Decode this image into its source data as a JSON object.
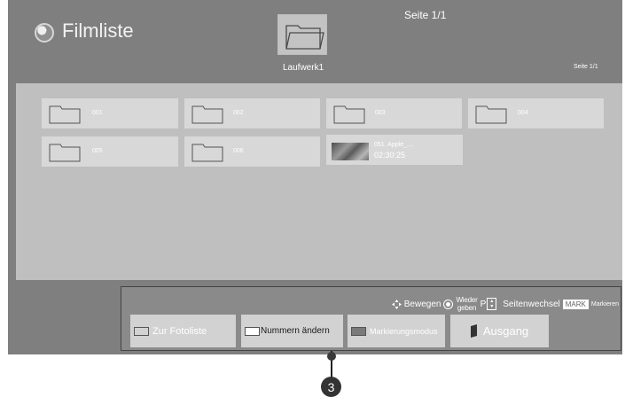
{
  "header": {
    "title": "Filmliste",
    "page_indicator": "Seite 1/1",
    "drive_label": "Laufwerk1",
    "page_indicator_small": "Seite 1/1",
    "app_icon": "film-reel-icon"
  },
  "items": [
    {
      "type": "folder",
      "name": "001"
    },
    {
      "type": "folder",
      "name": "002"
    },
    {
      "type": "folder",
      "name": "003"
    },
    {
      "type": "folder",
      "name": "004"
    },
    {
      "type": "folder",
      "name": "005"
    },
    {
      "type": "folder",
      "name": "006"
    },
    {
      "type": "video",
      "name": "051. Apple_....",
      "duration": "02:30:25"
    }
  ],
  "footer": {
    "hints": {
      "move_label": "Bewegen",
      "play_label_line1": "Wieder",
      "play_label_line2": "geben",
      "page_key": "P",
      "page_change_label": "Seitenwechsel",
      "mark_key": "MARK",
      "mark_label": "Markieren"
    },
    "buttons": {
      "photo_list": "Zur Fotoliste",
      "change_numbers": "Nummern ändern",
      "mark_mode": "Markierungsmodus",
      "exit": "Ausgang"
    }
  },
  "callout": {
    "number": "3"
  },
  "colors": {
    "screen_bg": "#7f7f7f",
    "content_bg": "#bfbfbf",
    "tile_bg": "#d8d8d8",
    "text": "#ffffff"
  }
}
